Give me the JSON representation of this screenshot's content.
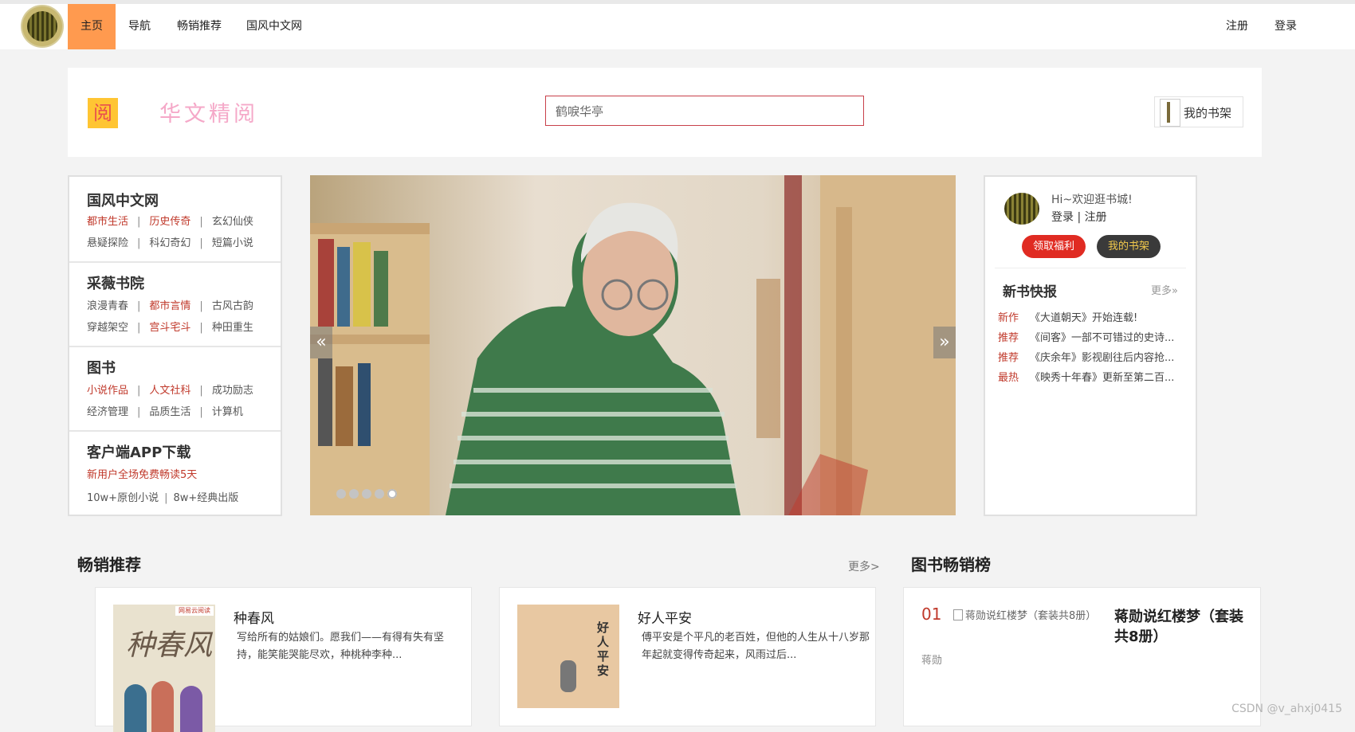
{
  "nav": {
    "items": [
      {
        "label": "主页",
        "active": true
      },
      {
        "label": "导航"
      },
      {
        "label": "畅销推荐"
      },
      {
        "label": "国风中文网"
      }
    ],
    "register": "注册",
    "login": "登录"
  },
  "header": {
    "logo_char": "阅",
    "brand": "华文精阅",
    "search_value": "鹤唳华亭",
    "my_shelf": "我的书架"
  },
  "categories": [
    {
      "title": "国风中文网",
      "rows": [
        [
          "都市生活",
          "历史传奇",
          "玄幻仙侠"
        ],
        [
          "悬疑探险",
          "科幻奇幻",
          "短篇小说"
        ]
      ]
    },
    {
      "title": "采薇书院",
      "rows": [
        [
          "浪漫青春",
          "都市言情",
          "古风古韵"
        ],
        [
          "穿越架空",
          "宫斗宅斗",
          "种田重生"
        ]
      ]
    },
    {
      "title": "图书",
      "rows": [
        [
          "小说作品",
          "人文社科",
          "成功励志"
        ],
        [
          "经济管理",
          "品质生活",
          "计算机"
        ]
      ]
    },
    {
      "title": "客户端APP下载",
      "promo": "新用户全场免费畅读5天",
      "stats": [
        "10w+原创小说",
        "8w+经典出版"
      ]
    }
  ],
  "carousel": {
    "prev": "«",
    "next": "»",
    "dot_count": 5,
    "active_dot": 4
  },
  "welcome": {
    "greeting": "Hi~欢迎逛书城!",
    "login_register": "登录 | 注册",
    "benefit_button": "领取福利",
    "shelf_button": "我的书架"
  },
  "news": {
    "title": "新书快报",
    "more": "更多»",
    "items": [
      {
        "tag": "新作",
        "text": "《大道朝天》开始连载!"
      },
      {
        "tag": "推荐",
        "text": "《间客》一部不可错过的史诗..."
      },
      {
        "tag": "推荐",
        "text": "《庆余年》影视剧往后内容抢..."
      },
      {
        "tag": "最热",
        "text": "《映秀十年春》更新至第二百..."
      }
    ]
  },
  "bestsellers": {
    "title": "畅销推荐",
    "more": "更多>",
    "books": [
      {
        "title": "种春风",
        "desc": "写给所有的姑娘们。愿我们——有得有失有坚持，能笑能哭能尽欢，种桃种李种...",
        "cover_title": "种春风",
        "cover_badge": "网易云阅读"
      },
      {
        "title": "好人平安",
        "desc": "傅平安是个平凡的老百姓，但他的人生从十八岁那年起就变得传奇起来，风雨过后...",
        "cover_title": "好人平安"
      }
    ]
  },
  "ranking": {
    "title": "图书畅销榜",
    "items": [
      {
        "rank": "01",
        "image_alt": "蒋勋说红楼梦（套装共8册）",
        "title": "蒋勋说红楼梦（套装共8册）",
        "author": "蒋勋"
      }
    ]
  },
  "watermark": "CSDN @v_ahxj0415",
  "colors": {
    "accent_orange": "#ff9a4f",
    "red": "#c0392b",
    "search_border": "#c8404a",
    "benefit": "#e02b22",
    "shelf_dark": "#3a3a3a"
  }
}
